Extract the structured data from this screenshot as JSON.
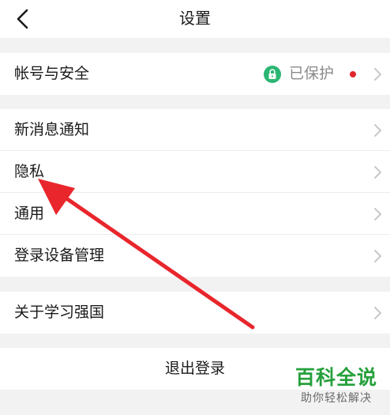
{
  "header": {
    "title": "设置",
    "back_icon": "chevron-left-icon"
  },
  "account": {
    "label": "帐号与安全",
    "status": "已保护",
    "lock_icon": "lock-icon",
    "lock_color": "#2bb673",
    "dot_color": "#e0262c"
  },
  "group2": {
    "items": [
      "新消息通知",
      "隐私",
      "通用",
      "登录设备管理"
    ]
  },
  "about": {
    "label": "关于学习强国"
  },
  "logout": {
    "label": "退出登录"
  },
  "annotation": {
    "arrow_color": "#e8262c"
  },
  "watermark": {
    "main": "百科全说",
    "sub": "助你轻松解决",
    "color": "#25a03b"
  }
}
